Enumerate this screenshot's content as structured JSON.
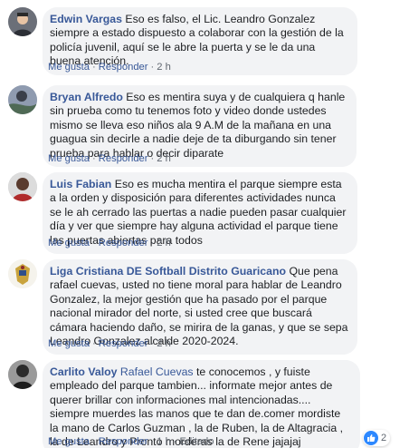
{
  "comments": [
    {
      "author": "Edwin Vargas",
      "text": "Eso es falso, el Lic. Leandro Gonzalez siempre a estado dispuesto a colaborar con la gestión de la policía juvenil, aquí se le abre la puerta y se le da una buena atención.",
      "like": "Me gusta",
      "reply": "Responder",
      "time": "2 h"
    },
    {
      "author": "Bryan Alfredo",
      "text": "Eso es mentira suya y de cualquiera q hanle sin prueba como tu tenemos foto y video donde ustedes mismo se lleva eso niños ala 9 A.M de la mañana en una guagua sin decirle a nadie deje de ta diburgando sin tener prueba para hablar o decir diparate",
      "like": "Me gusta",
      "reply": "Responder",
      "time": "2 h"
    },
    {
      "author": "Luis Fabian",
      "text": "Eso es mucha mentira el parque siempre esta a la orden y disposición para diferentes actividades nunca se le ah cerrado las puertas a nadie pueden pasar cualquier día y ver que siempre hay alguna actividad el parque tiene las puertas abiertas para todos",
      "like": "Me gusta",
      "reply": "Responder",
      "time": "2 h"
    },
    {
      "author": "Liga Cristiana DE Softball Distrito Guaricano",
      "text": "Que pena rafael cuevas, usted no tiene moral para hablar de Leandro Gonzalez, la mejor gestión que ha pasado por el parque nacional mirador del norte, si usted cree que buscará cámara haciendo daño, se mirira de la ganas, y que se sepa Leandro Gonzalez alcalde 2020-2024.",
      "like": "Me gusta",
      "reply": "Responder",
      "time": "2 h"
    },
    {
      "author": "Carlito Valoy",
      "mention": "Rafael Cuevas",
      "text": "te conocemos , y fuiste empleado del parque tambien... informate mejor antes de querer brillar con informaciones mal intencionadas.... siempre muerdes las manos que te dan de.comer mordiste la mano de Carlos Guzman , la de Ruben, la de Altagracia , la de Leandro y Pronto morderas la de Rene jajajaj",
      "like": "Me gusta",
      "reply": "Responder",
      "time": "1 h",
      "edited": "Editado"
    }
  ],
  "reactions": {
    "icon": "like-thumb-icon",
    "count": "2"
  },
  "colors": {
    "link": "#385898",
    "bubble": "#f2f3f5",
    "meta": "#606770",
    "like_badge": "#2d88ff"
  }
}
